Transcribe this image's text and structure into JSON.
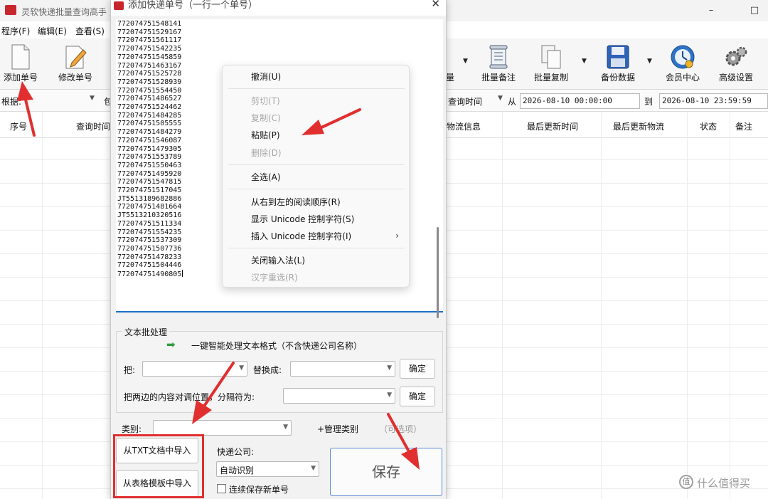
{
  "main": {
    "title": "灵软快递批量查询高手",
    "menu": [
      "程序(F)",
      "编辑(E)",
      "查看(S)"
    ],
    "toolbar": {
      "add": "添加单号",
      "edit": "修改单号",
      "partial": "量",
      "batch_note": "批量备注",
      "batch_copy": "批量复制",
      "backup": "备份数据",
      "member": "会员中心",
      "advanced": "高级设置"
    },
    "filter": {
      "basis_label": "根据:",
      "partial": "包",
      "time_field": "查询时间",
      "from_label": "从",
      "from_value": "2026-08-10 00:00:00",
      "to_label": "到",
      "to_value": "2026-08-10 23:59:59"
    },
    "columns": [
      "序号",
      "查询时间",
      "物流信息",
      "最后更新时间",
      "最后更新物流",
      "状态",
      "备注"
    ]
  },
  "dialog": {
    "title": "添加快递单号（一行一个单号）",
    "numbers": [
      "772074751548141",
      "772074751529167",
      "772074751561117",
      "772074751542235",
      "772074751545859",
      "772074751463167",
      "772074751525728",
      "772074751528939",
      "772074751554450",
      "772074751486527",
      "772074751524462",
      "772074751484285",
      "772074751505555",
      "772074751484279",
      "772074751546087",
      "772074751479305",
      "772074751553789",
      "772074751550463",
      "772074751495920",
      "772074751547815",
      "772074751517045",
      "JT5513189682886",
      "772074751481664",
      "JT5513210320516",
      "772074751511334",
      "772074751554235",
      "772074751537309",
      "772074751507736",
      "772074751478233",
      "772074751504446",
      "772074751490805"
    ],
    "batch": {
      "title": "文本批处理",
      "smart": "一键智能处理文本格式（不含快递公司名称）",
      "replace_from_label": "把:",
      "replace_to_label": "替换成:",
      "confirm": "确定",
      "swap_label": "把两边的内容对调位置，分隔符为:",
      "confirm2": "确定"
    },
    "category_label": "类别:",
    "manage_category": "+管理类别",
    "optional": "（可选项）",
    "import_txt": "从TXT文档中导入",
    "import_table": "从表格模板中导入",
    "courier_label": "快递公司:",
    "courier_value": "自动识别",
    "keep_saving": "连续保存新单号",
    "save": "保存"
  },
  "context_menu": {
    "undo": "撤消(U)",
    "cut": "剪切(T)",
    "copy": "复制(C)",
    "paste": "粘贴(P)",
    "delete": "删除(D)",
    "select_all": "全选(A)",
    "rtl": "从右到左的阅读顺序(R)",
    "show_unicode": "显示 Unicode 控制字符(S)",
    "insert_unicode": "插入 Unicode 控制字符(I)",
    "close_ime": "关闭输入法(L)",
    "reconvert": "汉字重选(R)"
  },
  "watermark": "什么值得买",
  "colors": {
    "annotation_red": "#e12f2f",
    "focus_blue": "#1d6fc9",
    "arrow_green": "#2f9e3c"
  }
}
